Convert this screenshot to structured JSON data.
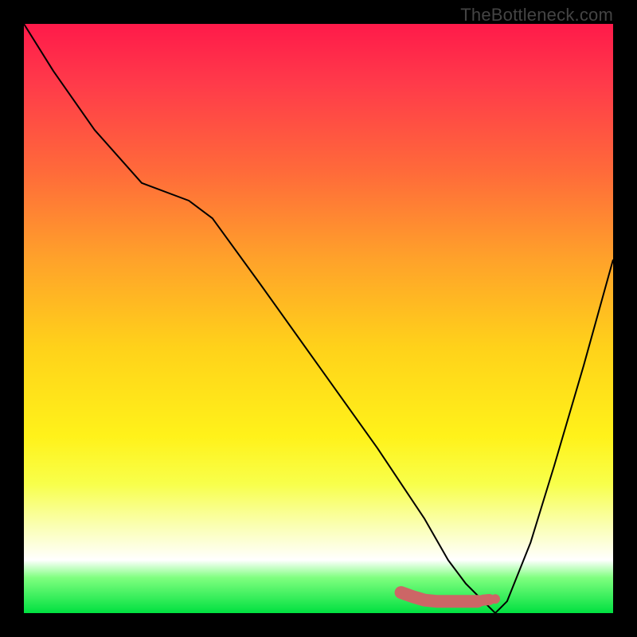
{
  "attribution": "TheBottleneck.com",
  "chart_data": {
    "type": "line",
    "title": "",
    "xlabel": "",
    "ylabel": "",
    "xlim": [
      0,
      100
    ],
    "ylim": [
      0,
      100
    ],
    "series": [
      {
        "name": "bottleneck-curve",
        "x": [
          0,
          5,
          12,
          20,
          28,
          32,
          40,
          50,
          60,
          68,
          72,
          75,
          78,
          80,
          82,
          86,
          90,
          95,
          100
        ],
        "values": [
          100,
          92,
          82,
          73,
          70,
          67,
          56,
          42,
          28,
          16,
          9,
          5,
          2,
          0,
          2,
          12,
          25,
          42,
          60
        ],
        "color": "#000000",
        "stroke_width": 2
      },
      {
        "name": "marker-blob",
        "x": [
          64,
          66,
          68,
          70,
          72,
          74,
          76,
          77,
          78,
          80
        ],
        "values": [
          3.5,
          2.8,
          2.2,
          2.0,
          2.0,
          2.0,
          2.0,
          2.0,
          2.2,
          2.4
        ],
        "color": "#cc6666",
        "stroke_width": 8
      }
    ],
    "gradient_stops": [
      {
        "pos": 0,
        "color": "#ff1a4a"
      },
      {
        "pos": 10,
        "color": "#ff3a4a"
      },
      {
        "pos": 25,
        "color": "#ff6a3a"
      },
      {
        "pos": 40,
        "color": "#ffa22a"
      },
      {
        "pos": 55,
        "color": "#ffd21a"
      },
      {
        "pos": 70,
        "color": "#fff21a"
      },
      {
        "pos": 78,
        "color": "#f8ff4a"
      },
      {
        "pos": 85,
        "color": "#faffb0"
      },
      {
        "pos": 91,
        "color": "#ffffff"
      },
      {
        "pos": 94,
        "color": "#7fff7f"
      },
      {
        "pos": 100,
        "color": "#00e040"
      }
    ]
  }
}
